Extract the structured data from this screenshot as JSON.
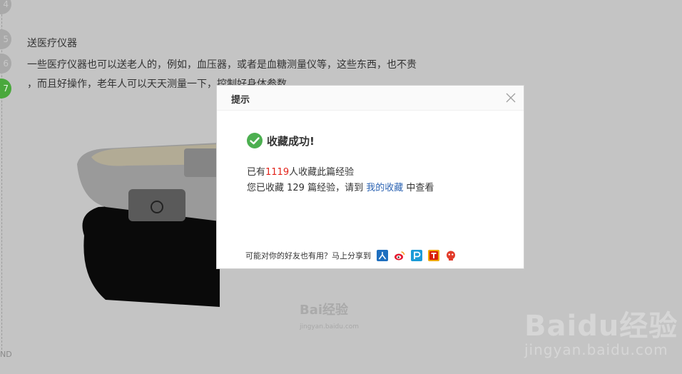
{
  "background": {
    "steps": [
      "4",
      "5",
      "6",
      "7"
    ],
    "active_step": "7",
    "end_label": "ND",
    "step_title": "送医疗仪器",
    "step_text_line1": "一些医疗仪器也可以送老人的，例如，血压器，或者是血糖测量仪等，这些东西，也不贵",
    "step_text_line2": "，而且好操作，老年人可以天天测量一下，控制好身体参数",
    "watermark_small": "Bai经验",
    "watermark_small_url": "jingyan.baidu.com",
    "watermark_big": "Baidu经验",
    "watermark_big_url": "jingyan.baidu.com"
  },
  "dialog": {
    "title": "提示",
    "success_text": "收藏成功!",
    "line1_prefix": "已有",
    "collect_count": "1119",
    "line1_suffix": "人收藏此篇经验",
    "line2_prefix": "您已收藏 129 篇经验，请到",
    "my_favorites_link": "我的收藏",
    "line2_suffix": "中查看",
    "share_label": "可能对你的好友也有用？马上分享到",
    "share_icons": [
      "renren-icon",
      "weibo-icon",
      "qzone-icon",
      "tieba-icon",
      "kaixin-icon"
    ]
  },
  "colors": {
    "overlay_bg": "#c0c0c0",
    "success_green": "#4caf50",
    "count_red": "#e2231a",
    "link_blue": "#2d64b3"
  }
}
